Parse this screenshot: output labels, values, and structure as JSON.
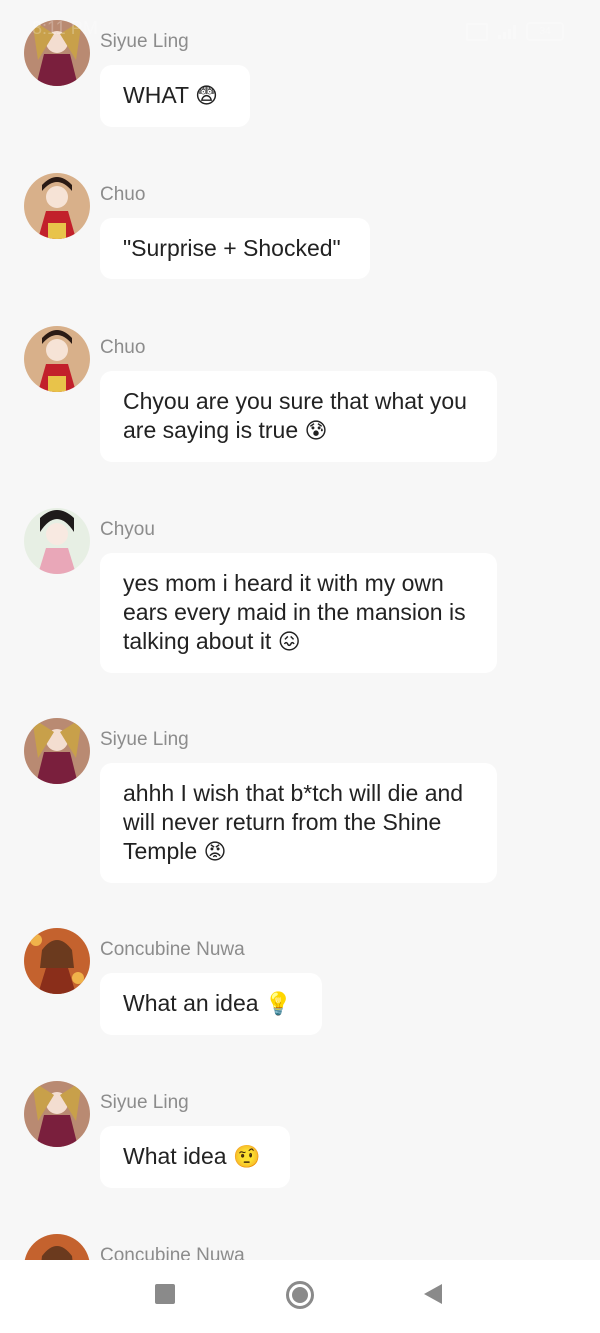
{
  "status_bar": {
    "time": "8:11 PM",
    "battery": "34"
  },
  "messages": [
    {
      "sender": "Siyue Ling",
      "text": "WHAT",
      "emoji": "😨",
      "avatar": "siyue"
    },
    {
      "sender": "Chuo",
      "text": "\"Surprise + Shocked\"",
      "emoji": "",
      "avatar": "chuo"
    },
    {
      "sender": "Chuo",
      "text": "Chyou are you sure that what you are saying is true",
      "emoji": "😰",
      "avatar": "chuo"
    },
    {
      "sender": "Chyou",
      "text": "yes mom i heard it with my own ears every maid in the mansion is talking about it",
      "emoji": "😖",
      "avatar": "chyou"
    },
    {
      "sender": "Siyue Ling",
      "text": "ahhh I wish that b*tch will die and will never return from the Shine Temple",
      "emoji": "😡",
      "avatar": "siyue"
    },
    {
      "sender": "Concubine Nuwa",
      "text": "What an idea",
      "emoji": "💡",
      "avatar": "nuwa"
    },
    {
      "sender": "Siyue Ling",
      "text": "What idea",
      "emoji": "🤨",
      "avatar": "siyue"
    },
    {
      "sender": "Concubine Nuwa",
      "text": "",
      "emoji": "",
      "avatar": "nuwa"
    }
  ],
  "icons": {
    "nav_recents": "square-icon",
    "nav_home": "circle-icon",
    "nav_back": "triangle-back-icon"
  },
  "colors": {
    "background": "#f7f7f7",
    "bubble": "#ffffff",
    "sender_text": "#8c8c8c",
    "message_text": "#222222",
    "nav_icon": "#8a8a8a"
  }
}
